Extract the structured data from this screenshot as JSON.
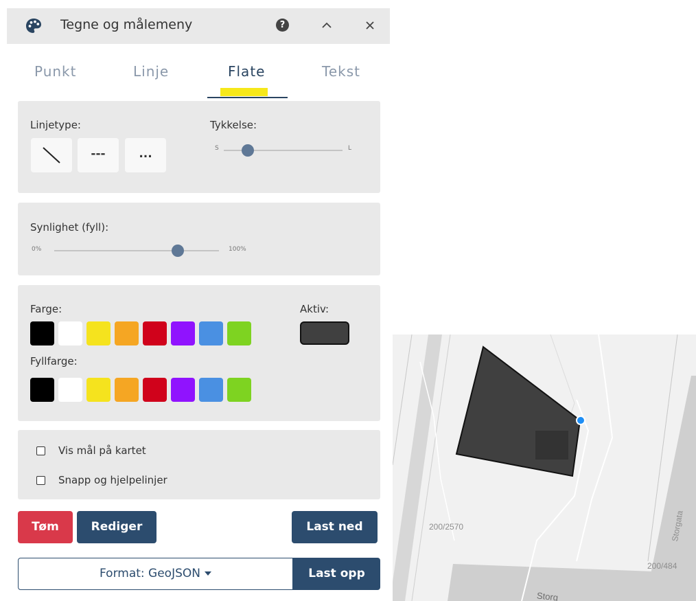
{
  "window": {
    "title": "Tegne og målemeny",
    "help_symbol": "?"
  },
  "tabs": [
    {
      "label": "Punkt",
      "active": false
    },
    {
      "label": "Linje",
      "active": false
    },
    {
      "label": "Flate",
      "active": true
    },
    {
      "label": "Tekst",
      "active": false
    }
  ],
  "line_settings": {
    "linetype_label": "Linjetype:",
    "linetype_options": [
      "solid",
      "---",
      "..."
    ],
    "thickness_label": "Tykkelse:",
    "thickness_min": "S",
    "thickness_max": "L",
    "thickness_value": 0.2
  },
  "opacity": {
    "label": "Synlighet (fyll):",
    "min": "0%",
    "max": "100%",
    "value": 0.75
  },
  "colors": {
    "color_label": "Farge:",
    "fill_label": "Fyllfarge:",
    "active_label": "Aktiv:",
    "palette": [
      "#000000",
      "#ffffff",
      "#f5e31e",
      "#f5a623",
      "#d0021b",
      "#9013fe",
      "#4a90e2",
      "#7ed321"
    ],
    "active_color": "#404040"
  },
  "options": {
    "show_measure": {
      "label": "Vis mål på kartet",
      "checked": false
    },
    "snap": {
      "label": "Snapp og hjelpelinjer",
      "checked": false
    }
  },
  "buttons": {
    "clear": "Tøm",
    "edit": "Rediger",
    "download": "Last ned",
    "format": "Format: GeoJSON",
    "upload": "Last opp"
  },
  "map": {
    "labels": [
      "200/2570",
      "Storgata",
      "200/484",
      "Storg"
    ]
  }
}
